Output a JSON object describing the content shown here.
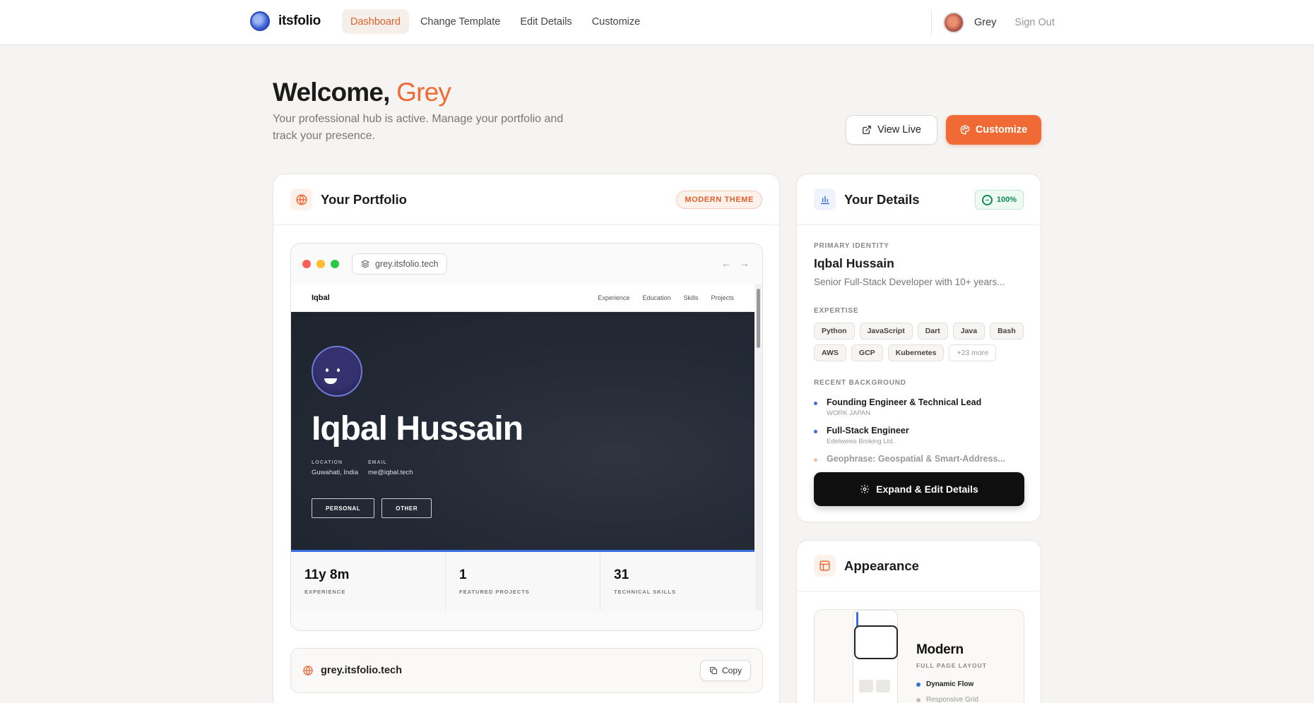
{
  "app": {
    "name": "itsfolio"
  },
  "nav": {
    "items": [
      {
        "label": "Dashboard",
        "active": true
      },
      {
        "label": "Change Template",
        "active": false
      },
      {
        "label": "Edit Details",
        "active": false
      },
      {
        "label": "Customize",
        "active": false
      }
    ],
    "user": "Grey",
    "signout": "Sign Out"
  },
  "header": {
    "welcome": "Welcome,",
    "name": "Grey",
    "subtitle": "Your professional hub is active. Manage your portfolio and track your presence.",
    "view_live": "View Live",
    "customize": "Customize"
  },
  "portfolio": {
    "title": "Your Portfolio",
    "badge": "MODERN THEME",
    "url": "grey.itsfolio.tech",
    "copy": "Copy",
    "preview": {
      "brand": "Iqbal",
      "links": [
        "Experience",
        "Education",
        "Skills",
        "Projects"
      ],
      "name": "Iqbal Hussain",
      "location_label": "LOCATION",
      "location": "Guwahati, India",
      "email_label": "EMAIL",
      "email": "me@iqbal.tech",
      "buttons": [
        "PERSONAL",
        "OTHER"
      ],
      "stats": [
        {
          "value": "11y 8m",
          "label": "EXPERIENCE"
        },
        {
          "value": "1",
          "label": "FEATURED PROJECTS"
        },
        {
          "value": "31",
          "label": "TECHNICAL SKILLS"
        }
      ]
    }
  },
  "details": {
    "title": "Your Details",
    "completion": "100%",
    "identity_label": "PRIMARY IDENTITY",
    "name": "Iqbal Hussain",
    "role": "Senior Full-Stack Developer with 10+ years...",
    "expertise_label": "EXPERTISE",
    "tags": [
      "Python",
      "JavaScript",
      "Dart",
      "Java",
      "Bash",
      "AWS",
      "GCP",
      "Kubernetes"
    ],
    "more": "+23 more",
    "background_label": "RECENT BACKGROUND",
    "background": [
      {
        "title": "Founding Engineer & Technical Lead",
        "sub": "WORK JAPAN"
      },
      {
        "title": "Full-Stack Engineer",
        "sub": "Edelweiss Broking Ltd."
      },
      {
        "title": "Geophrase: Geospatial & Smart-Address...",
        "sub": ""
      }
    ],
    "expand": "Expand & Edit Details"
  },
  "appearance": {
    "title": "Appearance",
    "layout_name": "Modern",
    "layout_sub": "FULL PAGE LAYOUT",
    "features": [
      "Dynamic Flow",
      "Responsive Grid"
    ]
  },
  "colors": {
    "accent": "#f06a35",
    "blue": "#3b6fe0",
    "green": "#0b8a54"
  }
}
